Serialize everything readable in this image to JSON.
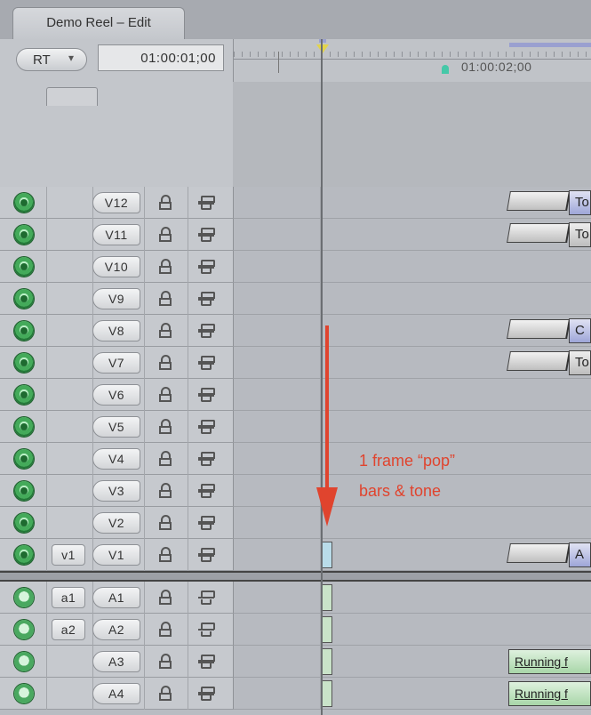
{
  "window": {
    "tab_title": "Demo Reel – Edit"
  },
  "toolbar": {
    "rt_label": "RT",
    "rt_arrow": "▾",
    "timecode": "01:00:01;00"
  },
  "ruler": {
    "timecode_label": "01:00:02;00"
  },
  "annotation": {
    "line1": "1 frame “pop”",
    "line2": "bars & tone",
    "color": "#e0442e"
  },
  "video_tracks": [
    {
      "dest": "V12",
      "src": "",
      "clip": {
        "type": "title",
        "label": "To"
      }
    },
    {
      "dest": "V11",
      "src": "",
      "clip": {
        "type": "blank",
        "label": "To"
      }
    },
    {
      "dest": "V10",
      "src": "",
      "clip": null
    },
    {
      "dest": "V9",
      "src": "",
      "clip": null
    },
    {
      "dest": "V8",
      "src": "",
      "clip": {
        "type": "title",
        "label": "C"
      }
    },
    {
      "dest": "V7",
      "src": "",
      "clip": {
        "type": "blank",
        "label": "To"
      }
    },
    {
      "dest": "V6",
      "src": "",
      "clip": null
    },
    {
      "dest": "V5",
      "src": "",
      "clip": null
    },
    {
      "dest": "V4",
      "src": "",
      "clip": null
    },
    {
      "dest": "V3",
      "src": "",
      "clip": null
    },
    {
      "dest": "V2",
      "src": "",
      "clip": null
    },
    {
      "dest": "V1",
      "src": "v1",
      "clip": {
        "type": "title",
        "label": "A"
      }
    }
  ],
  "audio_tracks": [
    {
      "dest": "A1",
      "src": "a1",
      "clip": null
    },
    {
      "dest": "A2",
      "src": "a2",
      "clip": null
    },
    {
      "dest": "A3",
      "src": "",
      "clip": {
        "type": "audio",
        "label": "Running f"
      }
    },
    {
      "dest": "A4",
      "src": "",
      "clip": {
        "type": "audio",
        "label": "Running f"
      }
    }
  ],
  "icons": {
    "visibility": "eye-icon",
    "audio": "speaker-icon",
    "lock": "lock-icon",
    "link": "link-icon"
  }
}
